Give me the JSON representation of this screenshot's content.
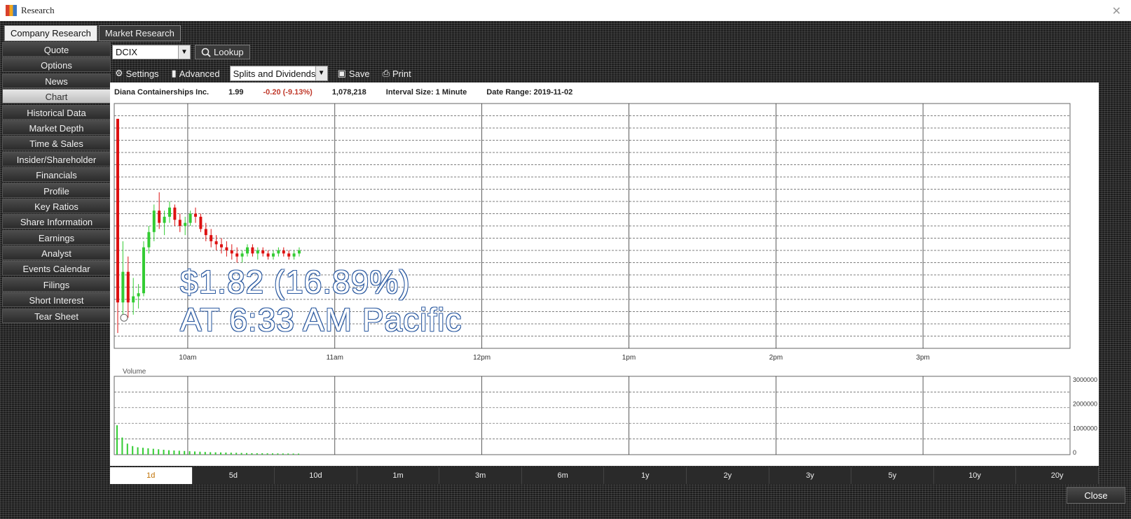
{
  "window": {
    "title": "Research"
  },
  "tabs": [
    {
      "label": "Company Research",
      "active": true
    },
    {
      "label": "Market Research",
      "active": false
    }
  ],
  "sidebar": {
    "items": [
      {
        "label": "Quote"
      },
      {
        "label": "Options"
      },
      {
        "label": "News"
      },
      {
        "label": "Chart",
        "active": true
      },
      {
        "label": "Historical Data"
      },
      {
        "label": "Market Depth"
      },
      {
        "label": "Time & Sales"
      },
      {
        "label": "Insider/Shareholder"
      },
      {
        "label": "Financials"
      },
      {
        "label": "Profile"
      },
      {
        "label": "Key Ratios"
      },
      {
        "label": "Share Information"
      },
      {
        "label": "Earnings"
      },
      {
        "label": "Analyst"
      },
      {
        "label": "Events Calendar"
      },
      {
        "label": "Filings"
      },
      {
        "label": "Short Interest"
      },
      {
        "label": "Tear Sheet"
      }
    ]
  },
  "toolbar": {
    "symbol": "DCIX",
    "lookup_label": "Lookup",
    "settings_label": "Settings",
    "advanced_label": "Advanced",
    "splits_select": "Splits and Dividends",
    "save_label": "Save",
    "print_label": "Print"
  },
  "info": {
    "company": "Diana Containerships Inc.",
    "price": "1.99",
    "change": "-0.20 (-9.13%)",
    "volume": "1,078,218",
    "interval": "Interval Size: 1 Minute",
    "date_range": "Date Range: 2019-11-02"
  },
  "overlay": {
    "line1": "$1.82 (16.89%)",
    "line2": "AT 6:33 AM Pacific"
  },
  "chart_data": {
    "type": "candlestick",
    "x_tick_labels": [
      "10am",
      "11am",
      "12pm",
      "1pm",
      "2pm",
      "3pm"
    ],
    "volume_label": "Volume",
    "volume_tick_labels": [
      "3000000",
      "2000000",
      "1000000",
      "0"
    ],
    "candles": [
      [
        2.2,
        2.2,
        1.5,
        1.6
      ],
      [
        1.6,
        1.8,
        1.55,
        1.7
      ],
      [
        1.7,
        1.75,
        1.55,
        1.6
      ],
      [
        1.6,
        1.68,
        1.56,
        1.62
      ],
      [
        1.62,
        1.66,
        1.58,
        1.63
      ],
      [
        1.63,
        1.8,
        1.62,
        1.78
      ],
      [
        1.78,
        1.85,
        1.76,
        1.83
      ],
      [
        1.83,
        1.92,
        1.8,
        1.9
      ],
      [
        1.9,
        1.96,
        1.84,
        1.86
      ],
      [
        1.86,
        1.9,
        1.82,
        1.88
      ],
      [
        1.88,
        1.93,
        1.86,
        1.91
      ],
      [
        1.91,
        1.92,
        1.85,
        1.87
      ],
      [
        1.87,
        1.89,
        1.83,
        1.85
      ],
      [
        1.85,
        1.88,
        1.82,
        1.86
      ],
      [
        1.86,
        1.9,
        1.85,
        1.89
      ],
      [
        1.89,
        1.91,
        1.86,
        1.88
      ],
      [
        1.88,
        1.89,
        1.83,
        1.84
      ],
      [
        1.84,
        1.86,
        1.8,
        1.82
      ],
      [
        1.82,
        1.84,
        1.78,
        1.8
      ],
      [
        1.8,
        1.82,
        1.77,
        1.79
      ],
      [
        1.79,
        1.81,
        1.76,
        1.78
      ],
      [
        1.78,
        1.8,
        1.75,
        1.77
      ],
      [
        1.77,
        1.79,
        1.74,
        1.76
      ],
      [
        1.76,
        1.78,
        1.73,
        1.75
      ],
      [
        1.75,
        1.77,
        1.73,
        1.76
      ],
      [
        1.76,
        1.79,
        1.75,
        1.78
      ],
      [
        1.78,
        1.79,
        1.75,
        1.76
      ],
      [
        1.76,
        1.78,
        1.74,
        1.77
      ],
      [
        1.77,
        1.78,
        1.75,
        1.76
      ],
      [
        1.76,
        1.77,
        1.74,
        1.75
      ],
      [
        1.75,
        1.77,
        1.74,
        1.76
      ],
      [
        1.76,
        1.78,
        1.75,
        1.77
      ],
      [
        1.77,
        1.78,
        1.75,
        1.76
      ],
      [
        1.76,
        1.77,
        1.74,
        1.75
      ],
      [
        1.75,
        1.77,
        1.74,
        1.76
      ],
      [
        1.76,
        1.78,
        1.75,
        1.77
      ]
    ],
    "volumes": [
      1200000,
      700000,
      450000,
      350000,
      300000,
      280000,
      260000,
      240000,
      220000,
      200000,
      180000,
      170000,
      160000,
      150000,
      140000,
      130000,
      120000,
      110000,
      100000,
      95000,
      90000,
      85000,
      80000,
      75000,
      70000,
      65000,
      60000,
      58000,
      56000,
      54000,
      52000,
      50000,
      48000,
      46000,
      44000,
      42000
    ],
    "up_color": "#33cc33",
    "down_color": "#dd1111"
  },
  "ranges": [
    {
      "label": "1d",
      "active": true
    },
    {
      "label": "5d"
    },
    {
      "label": "10d"
    },
    {
      "label": "1m"
    },
    {
      "label": "3m"
    },
    {
      "label": "6m"
    },
    {
      "label": "1y"
    },
    {
      "label": "2y"
    },
    {
      "label": "3y"
    },
    {
      "label": "5y"
    },
    {
      "label": "10y"
    },
    {
      "label": "20y"
    }
  ],
  "footer": {
    "close_label": "Close"
  }
}
